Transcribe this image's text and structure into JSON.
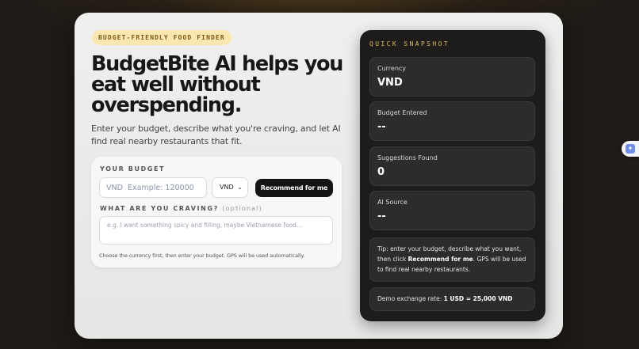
{
  "hero": {
    "badge": "BUDGET-FRIENDLY FOOD FINDER",
    "headline": "BudgetBite AI helps you eat well without overspending.",
    "subtitle": "Enter your budget, describe what you're craving, and let AI find real nearby restaurants that fit."
  },
  "form": {
    "budget_label": "YOUR BUDGET",
    "budget_placeholder": "VND  Example: 120000",
    "currency_value": "VND",
    "recommend_label": "Recommend for me",
    "craving_label": "WHAT ARE YOU CRAVING?",
    "craving_optional": "(optional)",
    "craving_placeholder": "e.g. I want something spicy and filling, maybe Vietnamese food...",
    "hint": "Choose the currency first, then enter your budget. GPS will be used automatically."
  },
  "snapshot": {
    "title": "QUICK SNAPSHOT",
    "stats": [
      {
        "label": "Currency",
        "value": "VND"
      },
      {
        "label": "Budget Entered",
        "value": "--"
      },
      {
        "label": "Suggestions Found",
        "value": "0"
      },
      {
        "label": "AI Source",
        "value": "--"
      }
    ],
    "tip_prefix": "Tip: enter your budget, describe what you want, then click ",
    "tip_bold": "Recommend for me",
    "tip_suffix": ". GPS will be used to find real nearby restaurants.",
    "rate_prefix": "Demo exchange rate: ",
    "rate_value": "1 USD = 25,000 VND"
  },
  "extension": {
    "icon": "extension-icon"
  },
  "colors": {
    "accent": "#d9b860",
    "badge_bg": "#fbe7b0",
    "panel_bg": "#1e1c1b",
    "button_bg": "#141414"
  }
}
